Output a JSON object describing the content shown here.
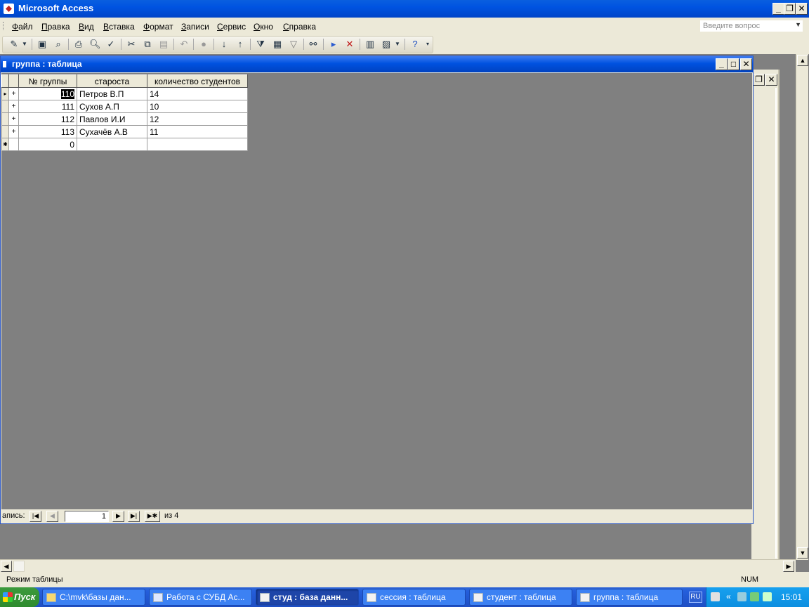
{
  "app": {
    "title": "Microsoft Access"
  },
  "menu": {
    "items": [
      "Файл",
      "Правка",
      "Вид",
      "Вставка",
      "Формат",
      "Записи",
      "Сервис",
      "Окно",
      "Справка"
    ],
    "ask_placeholder": "Введите вопрос"
  },
  "toolbar": {
    "buttons": [
      "view-icon",
      "save-icon",
      "search-file-icon",
      "print-icon",
      "print-preview-icon",
      "spelling-icon",
      "cut-icon",
      "copy-icon",
      "paste-icon",
      "undo-icon",
      "hyperlink-icon",
      "sort-ascending-icon",
      "sort-descending-icon",
      "filter-by-selection-icon",
      "filter-by-form-icon",
      "apply-filter-icon",
      "find-icon",
      "new-record-icon",
      "delete-record-icon",
      "database-window-icon",
      "new-object-icon",
      "help-icon"
    ]
  },
  "window": {
    "title": "группа : таблица",
    "columns": [
      "№ группы",
      "староста",
      "количество студентов"
    ],
    "rows": [
      {
        "num": "110",
        "head": "Петров В.П",
        "count": "14"
      },
      {
        "num": "111",
        "head": "Сухов А.П",
        "count": "10"
      },
      {
        "num": "112",
        "head": "Павлов И.И",
        "count": "12"
      },
      {
        "num": "113",
        "head": "Сухачёв А.В",
        "count": "11"
      }
    ],
    "new_row": {
      "num": "0"
    },
    "nav": {
      "label": "апись:",
      "current": "1",
      "of_text": "из 4"
    }
  },
  "status": {
    "text": "Режим таблицы",
    "num": "NUM"
  },
  "taskbar": {
    "start": "Пуск",
    "tasks": [
      "C:\\mvk\\базы дан...",
      "Работа с СУБД Ac...",
      "студ : база данн...",
      "сессия : таблица",
      "студент : таблица",
      "группа : таблица"
    ],
    "active_index": 2,
    "lang": "RU",
    "time": "15:01"
  },
  "colors": {
    "title_blue": "#0053e1",
    "face": "#ece9d8",
    "client_gray": "#808080",
    "taskbar": "#245edb"
  }
}
